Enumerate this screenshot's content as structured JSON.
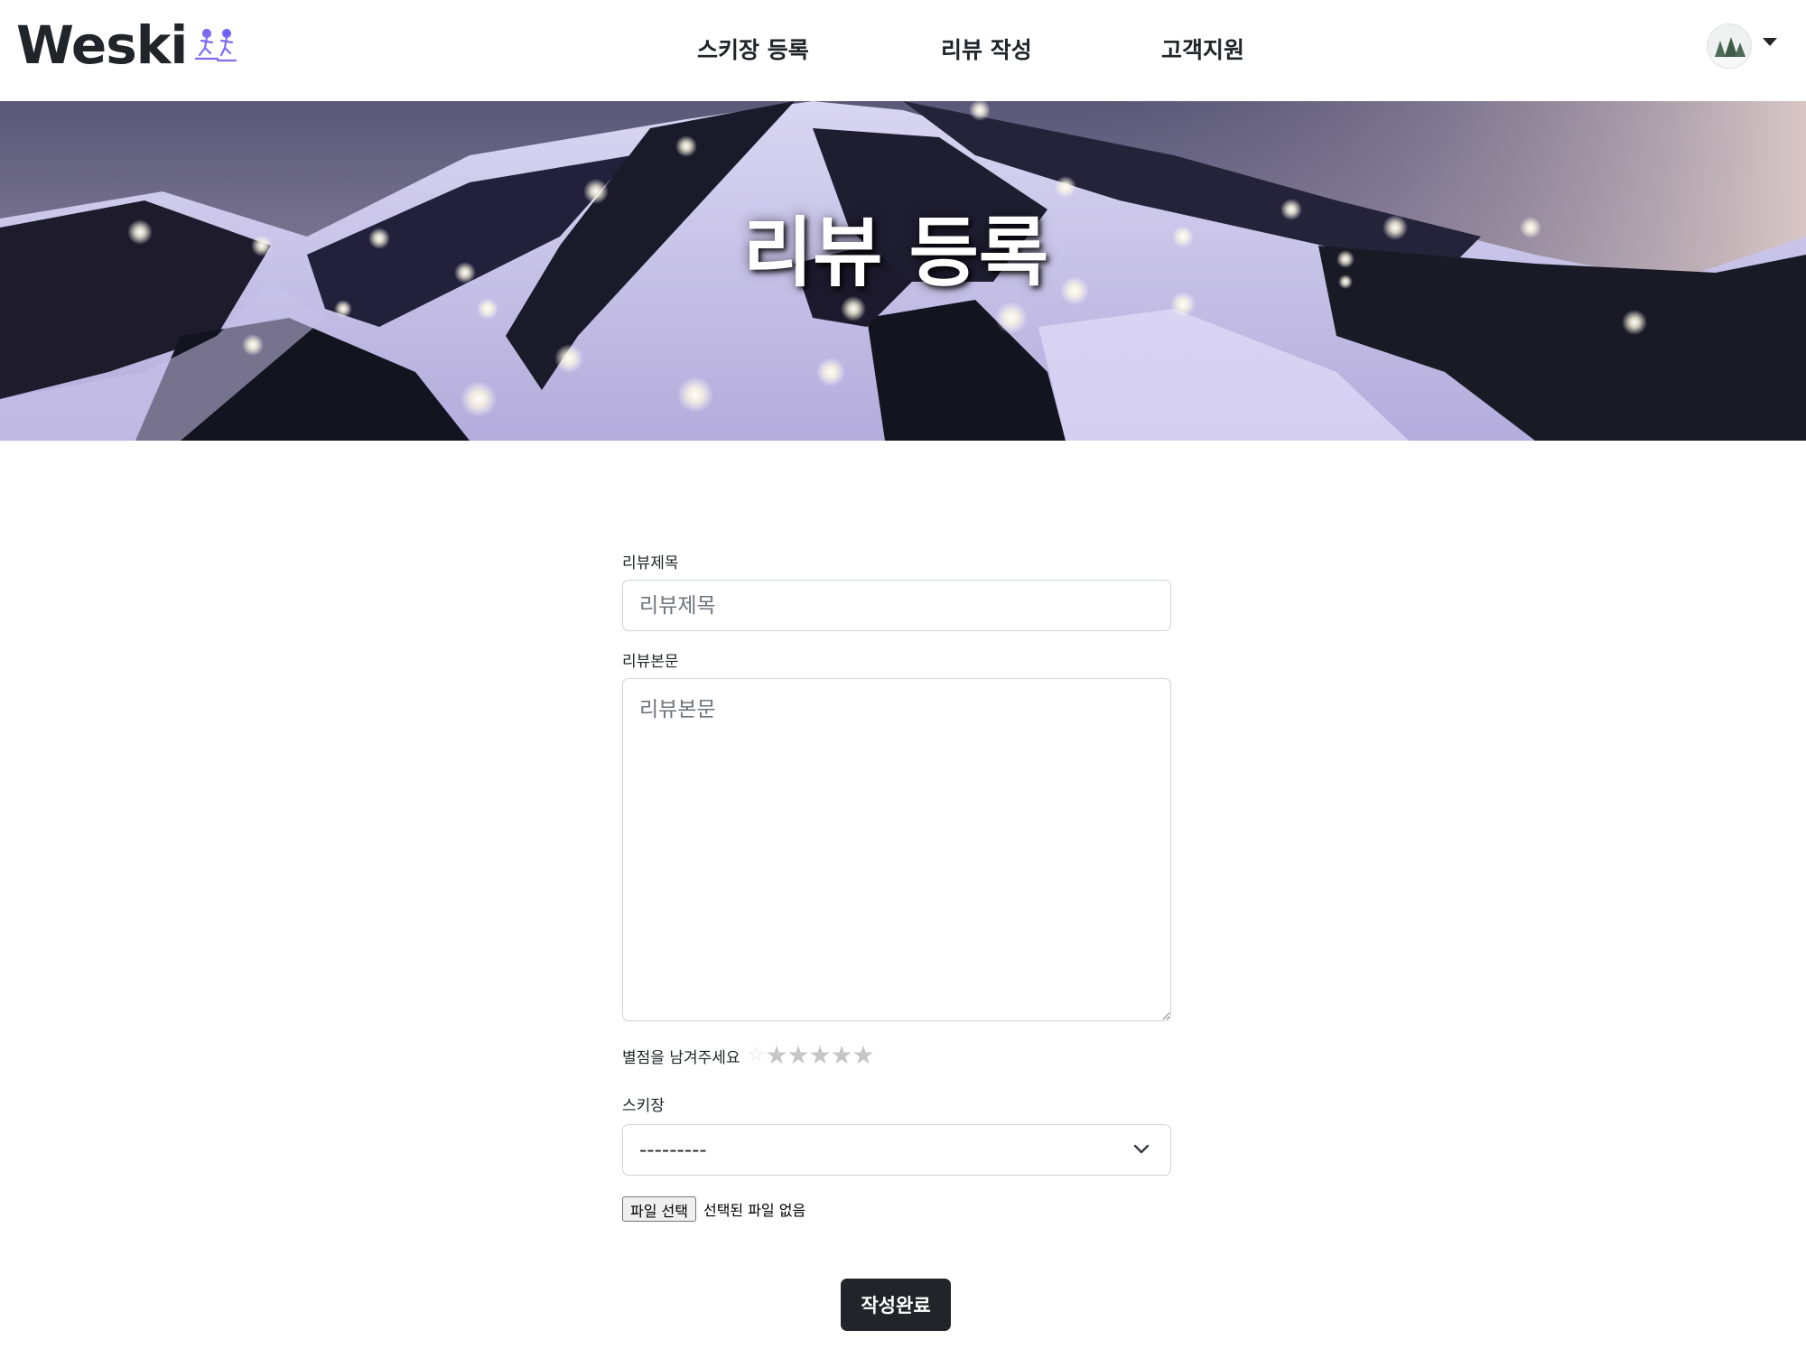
{
  "header": {
    "brand": "Weski",
    "nav": [
      {
        "label": "스키장 등록"
      },
      {
        "label": "리뷰 작성"
      },
      {
        "label": "고객지원"
      }
    ]
  },
  "hero": {
    "title": "리뷰 등록"
  },
  "form": {
    "title_label": "리뷰제목",
    "title_placeholder": "리뷰제목",
    "title_value": "",
    "body_label": "리뷰본문",
    "body_placeholder": "리뷰본문",
    "body_value": "",
    "rating_label": "별점을 남겨주세요",
    "rating_max": 5,
    "rating_value": 0,
    "resort_label": "스키장",
    "resort_options": [
      "---------"
    ],
    "resort_selected": "---------",
    "file_button": "파일 선택",
    "file_status": "선택된 파일 없음",
    "submit_label": "작성완료"
  },
  "colors": {
    "primary_dark": "#212529",
    "border": "#ced4da",
    "star_empty": "#c6c6c6"
  }
}
